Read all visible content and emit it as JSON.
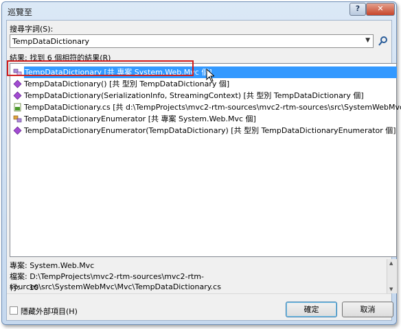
{
  "window": {
    "title": "巡覽至"
  },
  "search": {
    "label": "搜尋字詞(S):",
    "value": "TempDataDictionary"
  },
  "results": {
    "label": "結果: 找到 6 個相符的結果(R)",
    "items": [
      {
        "text": "TempDataDictionary [共 專案 System.Web.Mvc 個]",
        "icon": "class-icon",
        "selected": true
      },
      {
        "text": "TempDataDictionary() [共 型別 TempDataDictionary 個]",
        "icon": "method-icon"
      },
      {
        "text": "TempDataDictionary(SerializationInfo, StreamingContext) [共 型別 TempDataDictionary 個]",
        "icon": "method-icon"
      },
      {
        "text": "TempDataDictionary.cs [共 d:\\TempProjects\\mvc2-rtm-sources\\mvc2-rtm-sources\\src\\SystemWebMvc\\M...",
        "icon": "cs-file-icon"
      },
      {
        "text": "TempDataDictionaryEnumerator [共 專案 System.Web.Mvc 個]",
        "icon": "class-icon"
      },
      {
        "text": "TempDataDictionaryEnumerator(TempDataDictionary) [共 型別 TempDataDictionaryEnumerator 個]",
        "icon": "method-icon"
      }
    ]
  },
  "details": {
    "project": "專案: System.Web.Mvc",
    "file": "檔案: D:\\TempProjects\\mvc2-rtm-sources\\mvc2-rtm-sources\\src\\SystemWebMvc\\Mvc\\TempDataDictionary.cs",
    "line_label": "行:",
    "line_value": "10"
  },
  "options": {
    "hide_external_label": "隱藏外部項目(H)"
  },
  "buttons": {
    "ok": "確定",
    "cancel": "取消"
  },
  "colors": {
    "selection": "#3399ff",
    "callout": "#d01c1c"
  }
}
